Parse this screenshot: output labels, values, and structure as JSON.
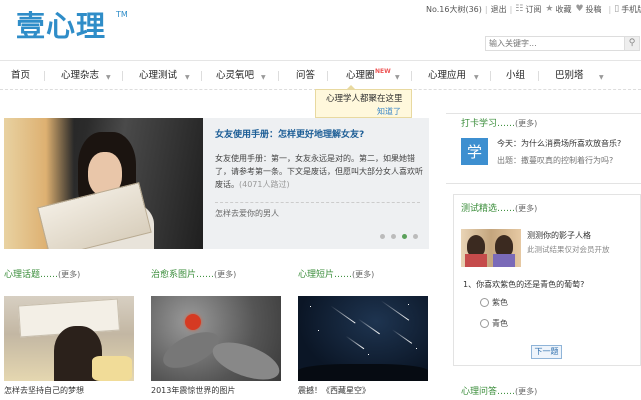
{
  "header": {
    "logo_text": "壹心理",
    "logo_tm": "TM",
    "user_label": "No.16大树(36)",
    "logout": "退出",
    "links": [
      {
        "icon": "rss-icon",
        "label": "订阅"
      },
      {
        "icon": "star-icon",
        "label": "收藏"
      },
      {
        "icon": "heart-icon",
        "label": "投稿"
      },
      {
        "icon": "mobile-icon",
        "label": "手机版"
      }
    ],
    "search_placeholder": "输入关键字..."
  },
  "nav": {
    "items": [
      "首页",
      "心理杂志",
      "心理测试",
      "心灵氧吧",
      "问答",
      "心理圈",
      "心理应用",
      "小组",
      "巴别塔"
    ],
    "new_badge": "NEW"
  },
  "tooltip": {
    "text": "心理学人都聚在这里",
    "close": "知道了"
  },
  "featured": {
    "title": "女友使用手册：怎样更好地理解女友?",
    "body": "女友使用手册：第一，女友永远是对的。第二，如果她错了，请参考第一条。下文是废话，但愿叫大部分女人喜欢听废话。",
    "count": "(4071人路过)",
    "sub": "怎样去爱你的男人"
  },
  "sections": [
    {
      "title": "心理话题……",
      "more": "(更多)",
      "caption": "怎样去坚持自己的梦想"
    },
    {
      "title": "治愈系图片……",
      "more": "(更多)",
      "caption": "2013年震惊世界的图片"
    },
    {
      "title": "心理短片……",
      "more": "(更多)",
      "caption": "震撼！《西藏星空》"
    }
  ],
  "sidebar": {
    "learn": {
      "title": "打卡学习……",
      "more": "(更多)",
      "icon_char": "学",
      "today": "今天：为什么消费场所喜欢放音乐?",
      "tomorrow": "出题：撒蔓叹真的控制着行为吗?"
    },
    "test": {
      "title": "测试精选……",
      "more": "(更多)",
      "name": "测测你的影子人格",
      "note": "此测试结果仅对会员开放",
      "question": "1、你喜欢紫色的还是青色的葡萄?",
      "options": [
        "紫色",
        "青色"
      ],
      "next": "下一题"
    },
    "qa": {
      "title": "心理问答……",
      "more": "(更多)"
    }
  }
}
